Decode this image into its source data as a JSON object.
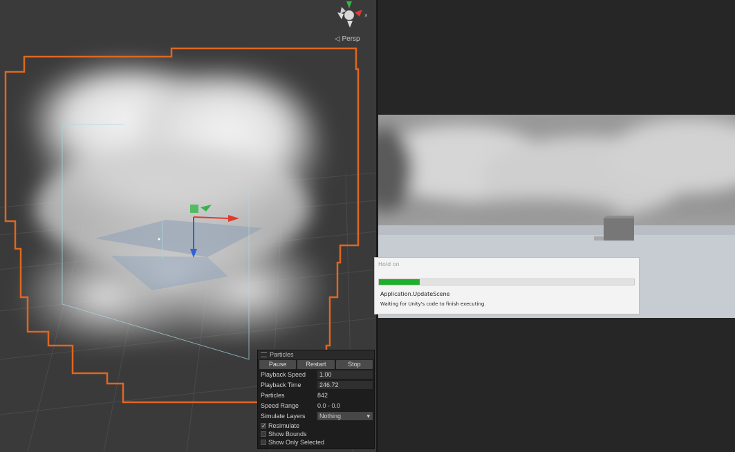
{
  "scene": {
    "view_mode_label": "◁ Persp"
  },
  "hold_dialog": {
    "title": "Hold on",
    "progress": 0.16,
    "task": "Application.UpdateScene",
    "message": "Waiting for Unity's code to finish executing."
  },
  "particles": {
    "title": "Particles",
    "buttons": {
      "pause": "Pause",
      "restart": "Restart",
      "stop": "Stop"
    },
    "playback_speed_label": "Playback Speed",
    "playback_speed": "1.00",
    "playback_time_label": "Playback Time",
    "playback_time": "246.72",
    "particles_label": "Particles",
    "particles_count": "842",
    "speed_range_label": "Speed Range",
    "speed_range": "0.0 - 0.0",
    "simulate_layers_label": "Simulate Layers",
    "simulate_layers": "Nothing",
    "resimulate_label": "Resimulate",
    "resimulate": true,
    "show_bounds_label": "Show Bounds",
    "show_bounds": false,
    "show_only_selected_label": "Show Only Selected",
    "show_only_selected": false
  },
  "colors": {
    "selection_outline": "#e0661f",
    "axis_x": "#e03a2f",
    "axis_y": "#34b648",
    "axis_z": "#2d63d8",
    "progress_fill": "#1fb02b"
  }
}
